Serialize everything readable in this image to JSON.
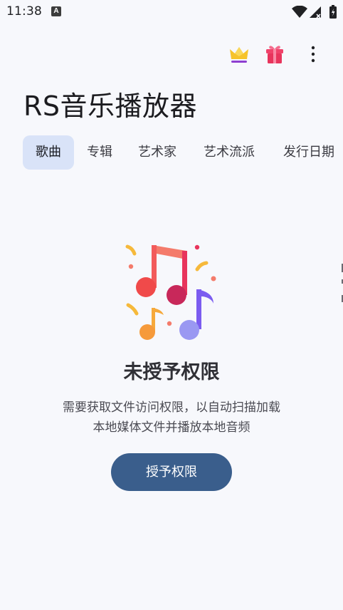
{
  "status_bar": {
    "time": "11:38",
    "app_icon_letter": "A"
  },
  "header": {
    "title": "RS音乐播放器",
    "actions": [
      {
        "name": "crown-icon",
        "color": "#f6c32a"
      },
      {
        "name": "gift-icon",
        "color": "#f0426a"
      },
      {
        "name": "more-vert-icon",
        "color": "#202124"
      }
    ]
  },
  "tabs": [
    {
      "label": "歌曲",
      "active": true
    },
    {
      "label": "专辑",
      "active": false
    },
    {
      "label": "艺术家",
      "active": false
    },
    {
      "label": "艺术流派",
      "active": false
    },
    {
      "label": "发行日期",
      "active": false
    }
  ],
  "empty_state": {
    "illustration": "music-notes-icon",
    "title": "未授予权限",
    "description_lines": [
      "需要获取文件访问权限，以自动扫描加载",
      "本地媒体文件并播放本地音频"
    ],
    "button_label": "授予权限"
  },
  "colors": {
    "background": "#f7f8fc",
    "active_tab": "#d9e3f8",
    "primary_button": "#3a5e8c"
  }
}
